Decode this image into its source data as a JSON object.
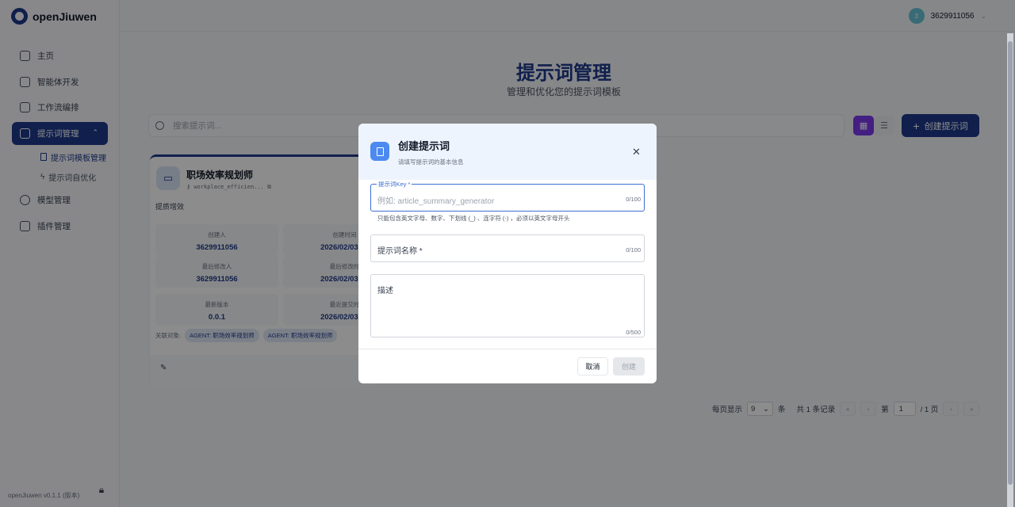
{
  "app": {
    "name": "openJiuwen",
    "version": "openJiuwen v0.1.1 (版本)"
  },
  "user": {
    "avatar_initial": "3",
    "name": "3629911056"
  },
  "sidebar": {
    "items": [
      {
        "label": "主页"
      },
      {
        "label": "智能体开发"
      },
      {
        "label": "工作流编排"
      },
      {
        "label": "提示词管理",
        "active": true
      },
      {
        "label": "模型管理"
      },
      {
        "label": "插件管理"
      }
    ],
    "subitems": [
      {
        "label": "提示词模板管理",
        "active": true
      },
      {
        "label": "提示词自优化"
      }
    ]
  },
  "header": {
    "title": "提示词管理",
    "subtitle": "管理和优化您的提示词模板"
  },
  "toolbar": {
    "search_placeholder": "搜索提示词...",
    "create_label": "创建提示词"
  },
  "card": {
    "title": "职场效率规划师",
    "key": "workplace_efficien...",
    "description": "提质增效",
    "stats": [
      {
        "label": "创建人",
        "value": "3629911056"
      },
      {
        "label": "创建时间",
        "value": "2026/02/03 16"
      },
      {
        "label": "最后修改人",
        "value": "3629911056"
      },
      {
        "label": "最后修改时",
        "value": "2026/02/03 16"
      },
      {
        "label": "最新版本",
        "value": "0.0.1"
      },
      {
        "label": "最近提交时",
        "value": "2026/02/03 16"
      }
    ],
    "assoc_label": "关联对象:",
    "tags": [
      "AGENT: 职场效率规划师",
      "AGENT: 职场效率规划师"
    ]
  },
  "pagination": {
    "per_page_label": "每页显示",
    "per_page_value": "9",
    "unit": "条",
    "total": "共 1 条记录",
    "page_prefix": "第",
    "page_value": "1",
    "page_suffix": "/ 1 页"
  },
  "modal": {
    "title": "创建提示词",
    "subtitle": "请填写提示词的基本信息",
    "key_field": {
      "legend": "提示词Key *",
      "placeholder": "例如: article_summary_generator",
      "count": "0/100",
      "help": "只能包含英文字母、数字、下划线 (_) 、连字符 (-) ，必须以英文字母开头"
    },
    "name_field": {
      "label": "提示词名称 *",
      "count": "0/100"
    },
    "desc_field": {
      "label": "描述",
      "count": "0/500"
    },
    "cancel_label": "取消",
    "create_label": "创建"
  },
  "colors": {
    "brand": "#1e3a8a",
    "accent": "#4d8af0",
    "grid_view": "#7c3aed"
  }
}
